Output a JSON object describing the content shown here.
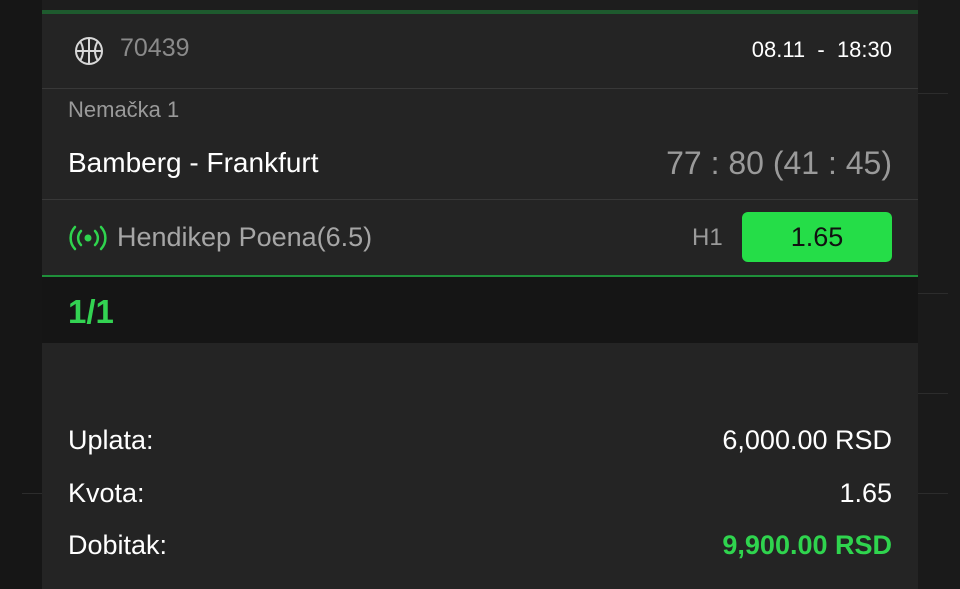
{
  "ticket": {
    "event_id": "70439",
    "sport_icon": "basketball-icon",
    "datetime": "08.11  -  18:30",
    "league": "Nemačka 1",
    "match": "Bamberg - Frankfurt",
    "score": "77 : 80 (41 : 45)",
    "live_icon": "live-broadcast-icon",
    "market": "Hendikep Poena(6.5)",
    "pick": "H1",
    "odd": "1.65",
    "count": "1/1"
  },
  "summary": {
    "stake_label": "Uplata:",
    "stake_value": "6,000.00 RSD",
    "odds_label": "Kvota:",
    "odds_value": "1.65",
    "win_label": "Dobitak:",
    "win_value": "9,900.00 RSD"
  },
  "colors": {
    "accent_green": "#25dd48",
    "win_green": "#2fd44e",
    "card_bg": "#242424"
  }
}
